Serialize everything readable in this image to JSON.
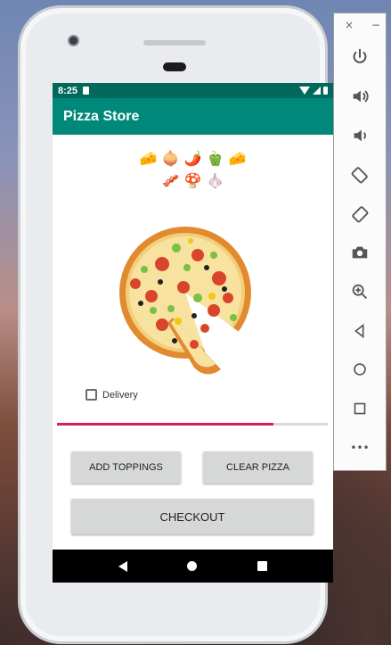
{
  "status_bar": {
    "time": "8:25"
  },
  "app_bar": {
    "title": "Pizza Store"
  },
  "toppings": {
    "row1": [
      "🧀",
      "🧅",
      "🌶️",
      "🫑",
      "🧀"
    ],
    "row2": [
      "🥓",
      "🍄",
      "🧄"
    ]
  },
  "delivery": {
    "label": "Delivery",
    "checked": false
  },
  "progress": {
    "value_percent": 80,
    "color": "#d81b60"
  },
  "buttons": {
    "add_toppings": "ADD TOPPINGS",
    "clear_pizza": "CLEAR PIZZA",
    "checkout": "CHECKOUT"
  },
  "emulator_panel": {
    "window_close": "×",
    "window_minimize": "−",
    "more": "•••",
    "icons": [
      "power-icon",
      "volume-up-icon",
      "volume-down-icon",
      "rotate-left-icon",
      "rotate-right-icon",
      "camera-icon",
      "zoom-icon",
      "back-icon",
      "home-icon",
      "overview-icon",
      "more-icon"
    ]
  },
  "colors": {
    "primary_dark": "#00695c",
    "primary": "#00897b",
    "accent": "#d81b60"
  }
}
